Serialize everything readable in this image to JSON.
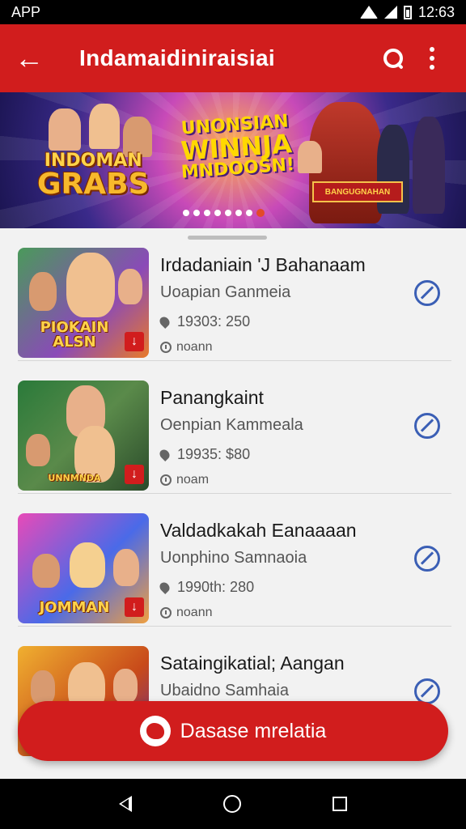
{
  "status_bar": {
    "left_text": "APP",
    "time": "12:63"
  },
  "app_bar": {
    "title": "Indamaidiniraisiai"
  },
  "banner": {
    "left_logo_line1": "INDOMAN",
    "left_logo_line2": "GRABS",
    "center_logo_line1": "UNONSIAN",
    "center_logo_line2": "WINNJA",
    "center_logo_line3": "MNDOOSN!",
    "plaque_text": "BANGUGNAHAN",
    "dot_count": 8,
    "active_dot": 7
  },
  "items": [
    {
      "name": "Irdadaniain 'J Bahanaam",
      "subtitle": "Uoapian Ganmeia",
      "meta": "19303: 250",
      "status": "noann",
      "thumb_label": "PIOKAIN ALSN"
    },
    {
      "name": "Panangkaint",
      "subtitle": "Oenpian Kammeala",
      "meta": "19935: $80",
      "status": "noam",
      "thumb_label": "UNNMNDA"
    },
    {
      "name": "Valdadkakah Eanaaaan",
      "subtitle": "Uonphino Samnaoia",
      "meta": "1990th: 280",
      "status": "noann",
      "thumb_label": "JOMMAN"
    },
    {
      "name": "Sataingikatial; Aangan",
      "subtitle": "Ubaidno Samhaia",
      "meta": "",
      "status": "",
      "thumb_label": ""
    }
  ],
  "cta": {
    "label": "Dasase mrelatia"
  },
  "colors": {
    "primary": "#d11d1d",
    "block_icon": "#3b5fb5"
  }
}
